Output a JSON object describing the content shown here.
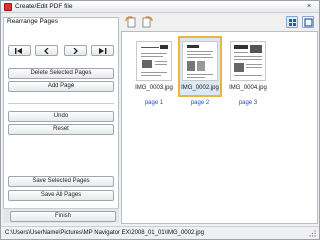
{
  "window": {
    "title": "Create/Edit PDF file",
    "close_glyph": "×"
  },
  "left_panel": {
    "rearrange_label": "Rearrange Pages",
    "nav_buttons": [
      "move-to-first-icon",
      "move-left-icon",
      "move-right-icon",
      "move-to-last-icon"
    ],
    "delete_selected": "Delete Selected Pages",
    "add_page": "Add Page",
    "undo": "Undo",
    "reset": "Reset",
    "save_selected": "Save Selected Pages",
    "save_all": "Save All Pages",
    "finish": "Finish"
  },
  "toolbar": {
    "icons": [
      "rotate-left-icon",
      "rotate-right-icon"
    ],
    "view_icons": [
      "thumbnail-view-icon",
      "large-view-icon"
    ]
  },
  "thumbnails": [
    {
      "filename": "IMG_0003.jpg",
      "page": "page 1",
      "selected": false
    },
    {
      "filename": "IMG_0002.jpg",
      "page": "page 2",
      "selected": true
    },
    {
      "filename": "IMG_0004.jpg",
      "page": "page 3",
      "selected": false
    }
  ],
  "status": {
    "path": "C:\\Users\\UserName\\Pictures\\MP Navigator EX\\2008_01_01\\IMG_0002.jpg"
  },
  "colors": {
    "selection_border": "#e8b63a",
    "page_label": "#1f4fb8",
    "selection_fill": "#dbe8f6"
  }
}
